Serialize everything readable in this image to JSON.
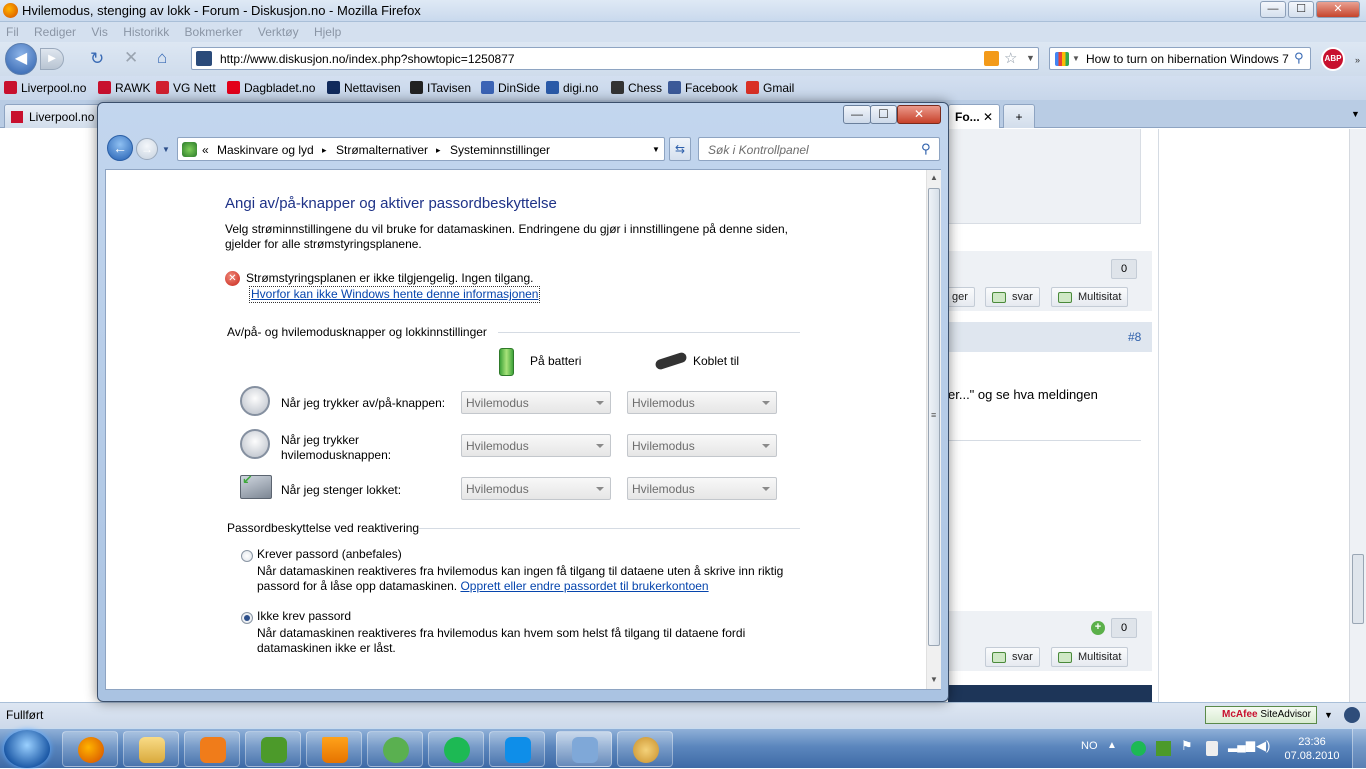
{
  "browser": {
    "title": "Hvilemodus, stenging av lokk - Forum - Diskusjon.no - Mozilla Firefox",
    "menu": [
      "Fil",
      "Rediger",
      "Vis",
      "Historikk",
      "Bokmerker",
      "Verktøy",
      "Hjelp"
    ],
    "url": "http://www.diskusjon.no/index.php?showtopic=1250877",
    "search_value": "How to turn on hibernation Windows 7",
    "abp": "ABP",
    "bookmarks": [
      "Liverpool.no",
      "RAWK",
      "VG Nett",
      "Dagbladet.no",
      "Nettavisen",
      "ITavisen",
      "DinSide",
      "digi.no",
      "Chess",
      "Facebook",
      "Gmail"
    ],
    "tabs": [
      "Liverpool.no",
      "Fo..."
    ],
    "status": "Fullført",
    "mcafee_a": "McAfee",
    "mcafee_b": "SiteAdvisor"
  },
  "web": {
    "count_top": "0",
    "count_bottom": "0",
    "btn_reply": "svar",
    "btn_quote": "Multisitat",
    "btn_partial": "ger",
    "post_number": "#8",
    "post_text": "er...\" og se hva meldingen"
  },
  "window": {
    "min": "—",
    "max": "☐",
    "close": "✕",
    "breadcrumbs": [
      "«",
      "Maskinvare og lyd",
      "▸",
      "Strømalternativer",
      "▸",
      "Systeminnstillinger"
    ],
    "search_placeholder": "Søk i Kontrollpanel"
  },
  "content": {
    "title": "Angi av/på-knapper og aktiver passordbeskyttelse",
    "intro_1": "Velg strøminnstillingene du vil bruke for datamaskinen. Endringene du gjør i innstillingene på denne siden,",
    "intro_2": "gjelder for alle strømstyringsplanene.",
    "error_text": "Strømstyringsplanen er ikke tilgjengelig. Ingen tilgang.",
    "error_link": "Hvorfor kan ikke Windows hente denne informasjonen",
    "group1_title": "Av/på- og hvilemodusknapper og lokkinnstillinger",
    "col_battery": "På batteri",
    "col_plugged": "Koblet til",
    "rows": [
      {
        "label": "Når jeg trykker av/på-knappen:",
        "battery": "Hvilemodus",
        "plugged": "Hvilemodus"
      },
      {
        "label_1": "Når jeg trykker",
        "label_2": "hvilemodusknappen:",
        "battery": "Hvilemodus",
        "plugged": "Hvilemodus"
      },
      {
        "label": "Når jeg stenger lokket:",
        "battery": "Hvilemodus",
        "plugged": "Hvilemodus"
      }
    ],
    "group2_title": "Passordbeskyttelse ved reaktivering",
    "opt1_label": "Krever passord (anbefales)",
    "opt1_desc_1": "Når datamaskinen reaktiveres fra hvilemodus kan ingen få tilgang til dataene uten å skrive inn riktig",
    "opt1_desc_2": "passord for å låse opp datamaskinen.",
    "opt1_link": "Opprett eller endre passordet til brukerkontoen",
    "opt2_label": "Ikke krev passord",
    "opt2_desc_1": "Når datamaskinen reaktiveres fra hvilemodus kan hvem som helst få tilgang til dataene fordi",
    "opt2_desc_2": "datamaskinen ikke er låst."
  },
  "tray": {
    "lang": "NO",
    "time": "23:36",
    "date": "07.08.2010"
  }
}
